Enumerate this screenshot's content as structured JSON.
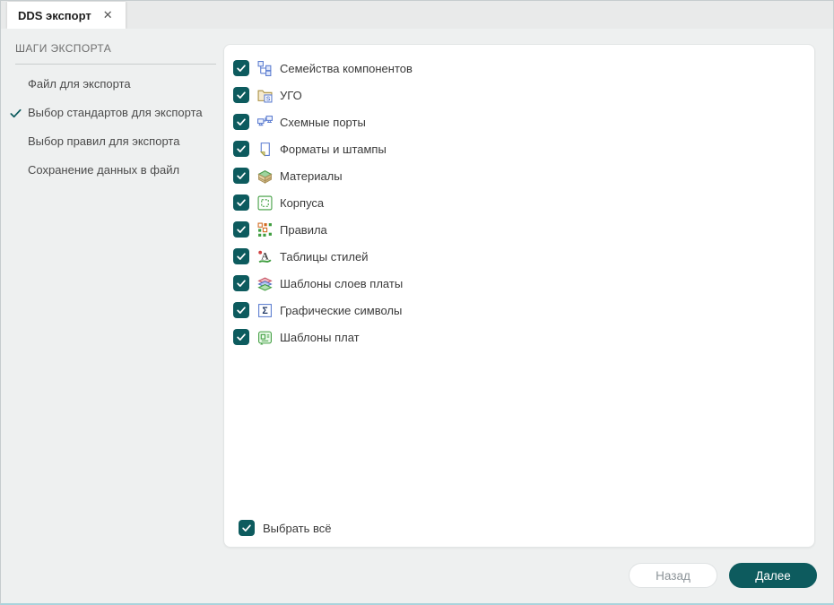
{
  "tab": {
    "title": "DDS экспорт",
    "close_icon": "✕"
  },
  "sidebar": {
    "header": "ШАГИ ЭКСПОРТА",
    "steps": [
      {
        "label": "Файл для экспорта",
        "state": "pending"
      },
      {
        "label": "Выбор стандартов для экспорта",
        "state": "current"
      },
      {
        "label": "Выбор правил для экспорта",
        "state": "pending"
      },
      {
        "label": "Сохранение данных в файл",
        "state": "pending"
      }
    ]
  },
  "export_items": [
    {
      "label": "Семейства компонентов",
      "checked": true,
      "icon": "component-families-icon"
    },
    {
      "label": "УГО",
      "checked": true,
      "icon": "ugo-folder-icon"
    },
    {
      "label": "Схемные порты",
      "checked": true,
      "icon": "schematic-ports-icon"
    },
    {
      "label": "Форматы и штампы",
      "checked": true,
      "icon": "formats-stamps-icon"
    },
    {
      "label": "Материалы",
      "checked": true,
      "icon": "materials-icon"
    },
    {
      "label": "Корпуса",
      "checked": true,
      "icon": "packages-icon"
    },
    {
      "label": "Правила",
      "checked": true,
      "icon": "rules-icon"
    },
    {
      "label": "Таблицы стилей",
      "checked": true,
      "icon": "style-tables-icon"
    },
    {
      "label": "Шаблоны слоев платы",
      "checked": true,
      "icon": "board-layers-icon"
    },
    {
      "label": "Графические символы",
      "checked": true,
      "icon": "graphic-symbols-icon"
    },
    {
      "label": "Шаблоны плат",
      "checked": true,
      "icon": "board-templates-icon"
    }
  ],
  "select_all": {
    "label": "Выбрать всё",
    "checked": true
  },
  "footer": {
    "back_label": "Назад",
    "next_label": "Далее"
  },
  "colors": {
    "accent_teal": "#0d5b5e",
    "tab_bar": "#e9eaea",
    "panel_bg": "#eef0f0"
  }
}
